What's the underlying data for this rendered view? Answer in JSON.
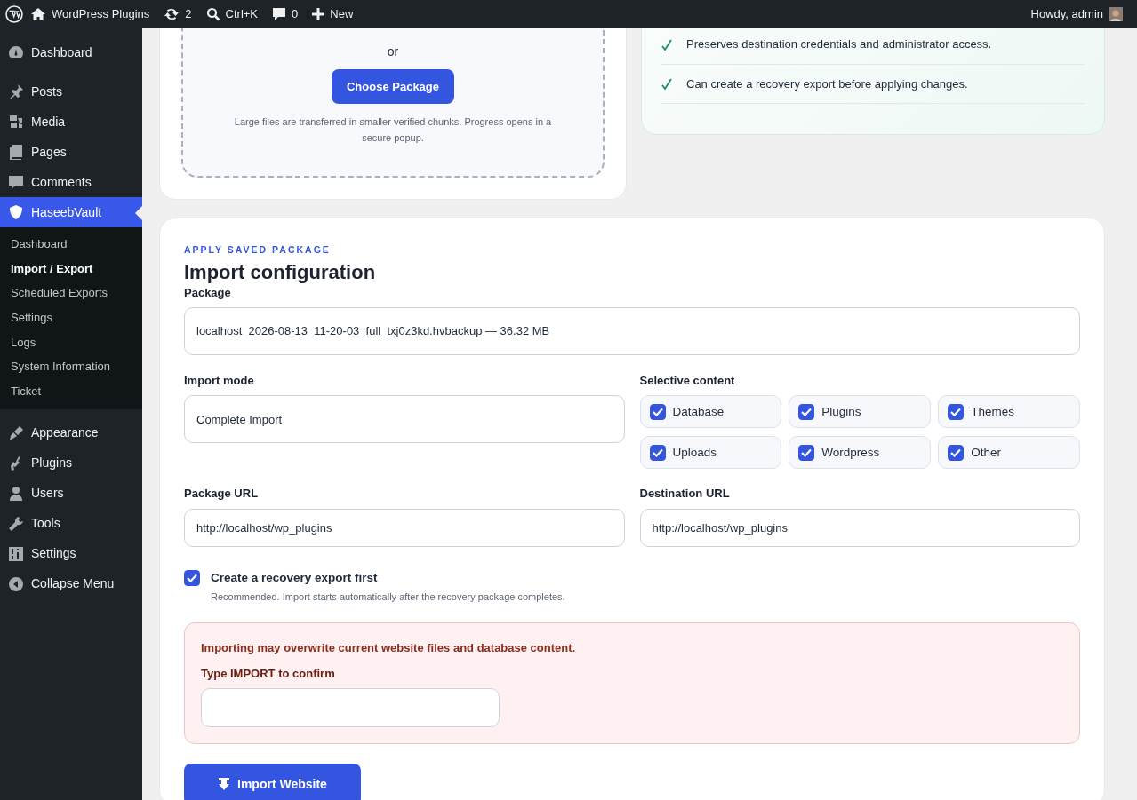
{
  "admin_bar": {
    "site": "WordPress Plugins",
    "updates": "2",
    "search": "Ctrl+K",
    "comments": "0",
    "new": "New",
    "greeting": "Howdy, admin"
  },
  "sidebar": {
    "items": [
      {
        "label": "Dashboard",
        "selected": false
      },
      {
        "label": "Posts",
        "selected": false
      },
      {
        "label": "Media",
        "selected": false
      },
      {
        "label": "Pages",
        "selected": false
      },
      {
        "label": "Comments",
        "selected": false
      },
      {
        "label": "HaseebVault",
        "selected": true,
        "children": [
          {
            "label": "Dashboard",
            "selected": false
          },
          {
            "label": "Import / Export",
            "selected": true
          },
          {
            "label": "Scheduled Exports",
            "selected": false
          },
          {
            "label": "Settings",
            "selected": false
          },
          {
            "label": "Logs",
            "selected": false
          },
          {
            "label": "System Information",
            "selected": false
          },
          {
            "label": "Ticket",
            "selected": false
          }
        ]
      },
      {
        "label": "Appearance",
        "selected": false
      },
      {
        "label": "Plugins",
        "selected": false
      },
      {
        "label": "Users",
        "selected": false
      },
      {
        "label": "Tools",
        "selected": false
      },
      {
        "label": "Settings",
        "selected": false
      },
      {
        "label": "Collapse Menu",
        "selected": false
      }
    ]
  },
  "upload": {
    "or": "or",
    "button": "Choose Package",
    "hint": "Large files are transferred in smaller verified chunks. Progress opens in a secure popup."
  },
  "features": [
    "Preserves destination credentials and administrator access.",
    "Can create a recovery export before applying changes."
  ],
  "import": {
    "eyebrow": "APPLY SAVED PACKAGE",
    "title": "Import configuration",
    "package": {
      "label": "Package",
      "value": "localhost_2026-08-13_11-20-03_full_txj0z3kd.hvbackup — 36.32 MB"
    },
    "mode": {
      "label": "Import mode",
      "value": "Complete Import"
    },
    "selective": {
      "label": "Selective content",
      "options": [
        {
          "label": "Database",
          "checked": true
        },
        {
          "label": "Plugins",
          "checked": true
        },
        {
          "label": "Themes",
          "checked": true
        },
        {
          "label": "Uploads",
          "checked": true
        },
        {
          "label": "Wordpress",
          "checked": true
        },
        {
          "label": "Other",
          "checked": true
        }
      ]
    },
    "package_url": {
      "label": "Package URL",
      "value": "http://localhost/wp_plugins"
    },
    "destination_url": {
      "label": "Destination URL",
      "value": "http://localhost/wp_plugins"
    },
    "recovery": {
      "label": "Create a recovery export first",
      "hint": "Recommended. Import starts automatically after the recovery package completes.",
      "checked": true
    },
    "warning": {
      "text": "Importing may overwrite current website files and database content.",
      "confirm_label": "Type IMPORT to confirm"
    },
    "submit": "Import Website"
  }
}
